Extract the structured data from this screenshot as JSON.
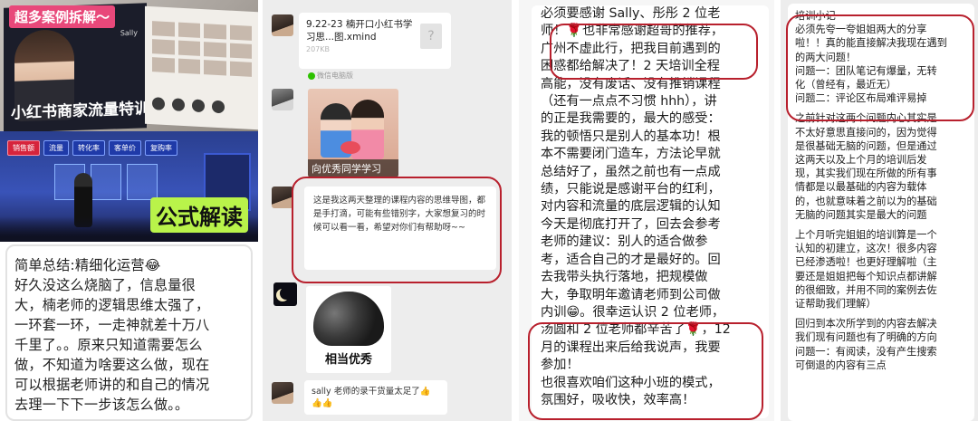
{
  "panel1": {
    "case_tag": "超多案例拆解～",
    "book_cover_title": "小红书商家流量特训营",
    "book_brand": "Sally",
    "stage_banner": [
      "销售额",
      "流量",
      "转化率",
      "客单价",
      "复购率"
    ],
    "formula_label": "公式解读",
    "note_lines": [
      "简单总结:精细化运营😂",
      "好久没这么烧脑了，信息量很",
      "大，楠老师的逻辑思维太强了，",
      "一环套一环，一走神就差十万八",
      "千里了。。原来只知道需要怎么",
      "做，不知道为啥要这么做，现在",
      "可以根据老师讲的和自己的情况",
      "去理一下下一步该怎么做。。"
    ]
  },
  "panel2": {
    "file_name": "9.22-23 楠开口小红书学习思...图.xmind",
    "file_size": "207KB",
    "file_source": "微信电脑版",
    "image_caption": "向优秀同学学习",
    "message": "这是我这两天整理的课程内容的思维导图，都是手打滴，可能有些错别字，大家想复习的时候可以看一看，希望对你们有帮助呀~~",
    "meme_caption": "相当优秀",
    "short_message": "sally 老师的录干货量太足了👍👍👍"
  },
  "panel3": {
    "lines": [
      "必须要感谢 Sally、彤彤 2 位老",
      "师！🌹也非常感谢超哥的推荐，",
      "广州不虚此行，把我目前遇到的",
      "困惑都给解决了！2 天培训全程",
      "高能，没有废话、没有推销课程",
      "（还有一点点不习惯 hhh），讲",
      "的正是我需要的，最大的感受：",
      "我的顿悟只是别人的基本功！根",
      "本不需要闭门造车，方法论早就",
      "总结好了，虽然之前也有一点成",
      "绩，只能说是感谢平台的红利，",
      "对内容和流量的底层逻辑的认知",
      "今天是彻底打开了，回去会参考",
      "老师的建议：别人的适合做参",
      "考，适合自己的才是最好的。回",
      "去我带头执行落地，把规模做",
      "大，争取明年邀请老师到公司做",
      "内训😁。很幸运认识 2 位老师，",
      "汤圆和 2 位老师都辛苦了🌹，12",
      "月的课程出来后给我说声，我要",
      "参加！",
      "也很喜欢咱们这种小班的模式，",
      "氛围好，吸收快，效率高！"
    ]
  },
  "panel4": {
    "block1": [
      "培训小记",
      "必须先夸一夸姐姐两大的分享",
      "啦！！真的能直接解决我现在遇到",
      "的两大问题！",
      "问题一：团队笔记有爆量，无转",
      "化（曾经有，最近无）",
      "问题二：评论区布局难评易掉"
    ],
    "block2": [
      "之前针对这两个问题内心其实是",
      "不太好意思直接问的，因为觉得",
      "是很基础无脑的问题，但是通过",
      "这两天以及上个月的培训后发",
      "现，其实我们现在所做的所有事",
      "情都是以最基础的内容为载体",
      "的，也就意味着之前以为的基础",
      "无脑的问题其实是最大的问题"
    ],
    "block3": [
      "上个月听完姐姐的培训算是一个",
      "认知的初建立，这次！很多内容",
      "已经渗透啦！也更好理解啦（主",
      "要还是姐姐把每个知识点都讲解",
      "的很细致，并用不同的案例去佐",
      "证帮助我们理解）"
    ],
    "block4": [
      "回归到本次所学到的内容去解决",
      "我们现有问题也有了明确的方向",
      "问题一：有阅读，没有产生搜索",
      "可倒退的内容有三点"
    ]
  },
  "colors": {
    "highlight_border": "#b8202d",
    "tag_pink": "#e8487a",
    "formula_green": "#b9f34a",
    "chat_bg": "#ededed"
  }
}
